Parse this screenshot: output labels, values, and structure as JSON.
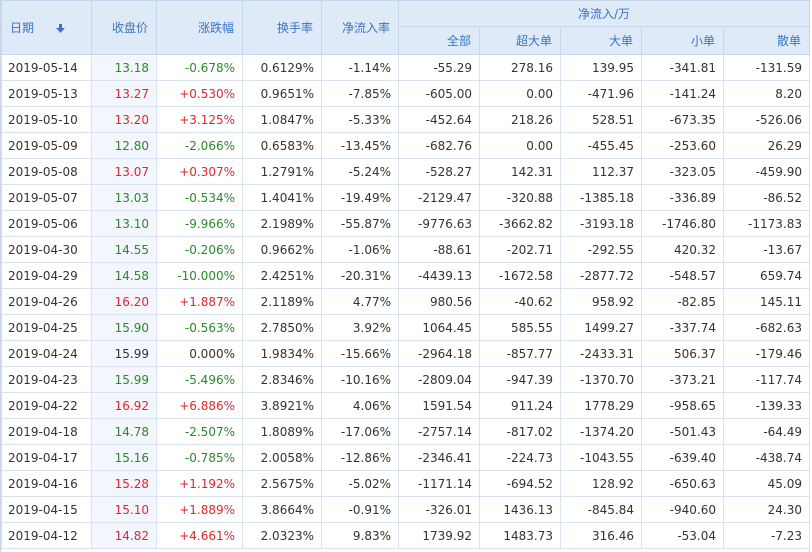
{
  "header": {
    "date": "日期",
    "close": "收盘价",
    "change": "涨跌幅",
    "turnover": "换手率",
    "netflow_rate": "净流入率",
    "netflow_group": "净流入/万",
    "all": "全部",
    "super": "超大单",
    "big": "大单",
    "small": "小单",
    "retail": "散单"
  },
  "colors": {
    "up": "#e0262c",
    "down": "#2a8a2a",
    "header_text": "#3a74c4",
    "header_bg": "#dfeaf9"
  },
  "sort_icon": "arrow-down-icon",
  "rows": [
    {
      "date": "2019-05-14",
      "close": "13.18",
      "change": "-0.678%",
      "turnover": "0.6129%",
      "rate": "-1.14%",
      "all": "-55.29",
      "super": "278.16",
      "big": "139.95",
      "small": "-341.81",
      "retail": "-131.59",
      "dir": "down"
    },
    {
      "date": "2019-05-13",
      "close": "13.27",
      "change": "+0.530%",
      "turnover": "0.9651%",
      "rate": "-7.85%",
      "all": "-605.00",
      "super": "0.00",
      "big": "-471.96",
      "small": "-141.24",
      "retail": "8.20",
      "dir": "up"
    },
    {
      "date": "2019-05-10",
      "close": "13.20",
      "change": "+3.125%",
      "turnover": "1.0847%",
      "rate": "-5.33%",
      "all": "-452.64",
      "super": "218.26",
      "big": "528.51",
      "small": "-673.35",
      "retail": "-526.06",
      "dir": "up"
    },
    {
      "date": "2019-05-09",
      "close": "12.80",
      "change": "-2.066%",
      "turnover": "0.6583%",
      "rate": "-13.45%",
      "all": "-682.76",
      "super": "0.00",
      "big": "-455.45",
      "small": "-253.60",
      "retail": "26.29",
      "dir": "down"
    },
    {
      "date": "2019-05-08",
      "close": "13.07",
      "change": "+0.307%",
      "turnover": "1.2791%",
      "rate": "-5.24%",
      "all": "-528.27",
      "super": "142.31",
      "big": "112.37",
      "small": "-323.05",
      "retail": "-459.90",
      "dir": "up"
    },
    {
      "date": "2019-05-07",
      "close": "13.03",
      "change": "-0.534%",
      "turnover": "1.4041%",
      "rate": "-19.49%",
      "all": "-2129.47",
      "super": "-320.88",
      "big": "-1385.18",
      "small": "-336.89",
      "retail": "-86.52",
      "dir": "down"
    },
    {
      "date": "2019-05-06",
      "close": "13.10",
      "change": "-9.966%",
      "turnover": "2.1989%",
      "rate": "-55.87%",
      "all": "-9776.63",
      "super": "-3662.82",
      "big": "-3193.18",
      "small": "-1746.80",
      "retail": "-1173.83",
      "dir": "down"
    },
    {
      "date": "2019-04-30",
      "close": "14.55",
      "change": "-0.206%",
      "turnover": "0.9662%",
      "rate": "-1.06%",
      "all": "-88.61",
      "super": "-202.71",
      "big": "-292.55",
      "small": "420.32",
      "retail": "-13.67",
      "dir": "down"
    },
    {
      "date": "2019-04-29",
      "close": "14.58",
      "change": "-10.000%",
      "turnover": "2.4251%",
      "rate": "-20.31%",
      "all": "-4439.13",
      "super": "-1672.58",
      "big": "-2877.72",
      "small": "-548.57",
      "retail": "659.74",
      "dir": "down"
    },
    {
      "date": "2019-04-26",
      "close": "16.20",
      "change": "+1.887%",
      "turnover": "2.1189%",
      "rate": "4.77%",
      "all": "980.56",
      "super": "-40.62",
      "big": "958.92",
      "small": "-82.85",
      "retail": "145.11",
      "dir": "up"
    },
    {
      "date": "2019-04-25",
      "close": "15.90",
      "change": "-0.563%",
      "turnover": "2.7850%",
      "rate": "3.92%",
      "all": "1064.45",
      "super": "585.55",
      "big": "1499.27",
      "small": "-337.74",
      "retail": "-682.63",
      "dir": "down"
    },
    {
      "date": "2019-04-24",
      "close": "15.99",
      "change": "0.000%",
      "turnover": "1.9834%",
      "rate": "-15.66%",
      "all": "-2964.18",
      "super": "-857.77",
      "big": "-2433.31",
      "small": "506.37",
      "retail": "-179.46",
      "dir": "flat"
    },
    {
      "date": "2019-04-23",
      "close": "15.99",
      "change": "-5.496%",
      "turnover": "2.8346%",
      "rate": "-10.16%",
      "all": "-2809.04",
      "super": "-947.39",
      "big": "-1370.70",
      "small": "-373.21",
      "retail": "-117.74",
      "dir": "down"
    },
    {
      "date": "2019-04-22",
      "close": "16.92",
      "change": "+6.886%",
      "turnover": "3.8921%",
      "rate": "4.06%",
      "all": "1591.54",
      "super": "911.24",
      "big": "1778.29",
      "small": "-958.65",
      "retail": "-139.33",
      "dir": "up"
    },
    {
      "date": "2019-04-18",
      "close": "14.78",
      "change": "-2.507%",
      "turnover": "1.8089%",
      "rate": "-17.06%",
      "all": "-2757.14",
      "super": "-817.02",
      "big": "-1374.20",
      "small": "-501.43",
      "retail": "-64.49",
      "dir": "down"
    },
    {
      "date": "2019-04-17",
      "close": "15.16",
      "change": "-0.785%",
      "turnover": "2.0058%",
      "rate": "-12.86%",
      "all": "-2346.41",
      "super": "-224.73",
      "big": "-1043.55",
      "small": "-639.40",
      "retail": "-438.74",
      "dir": "down"
    },
    {
      "date": "2019-04-16",
      "close": "15.28",
      "change": "+1.192%",
      "turnover": "2.5675%",
      "rate": "-5.02%",
      "all": "-1171.14",
      "super": "-694.52",
      "big": "128.92",
      "small": "-650.63",
      "retail": "45.09",
      "dir": "up"
    },
    {
      "date": "2019-04-15",
      "close": "15.10",
      "change": "+1.889%",
      "turnover": "3.8664%",
      "rate": "-0.91%",
      "all": "-326.01",
      "super": "1436.13",
      "big": "-845.84",
      "small": "-940.60",
      "retail": "24.30",
      "dir": "up"
    },
    {
      "date": "2019-04-12",
      "close": "14.82",
      "change": "+4.661%",
      "turnover": "2.0323%",
      "rate": "9.83%",
      "all": "1739.92",
      "super": "1483.73",
      "big": "316.46",
      "small": "-53.04",
      "retail": "-7.23",
      "dir": "up"
    }
  ]
}
